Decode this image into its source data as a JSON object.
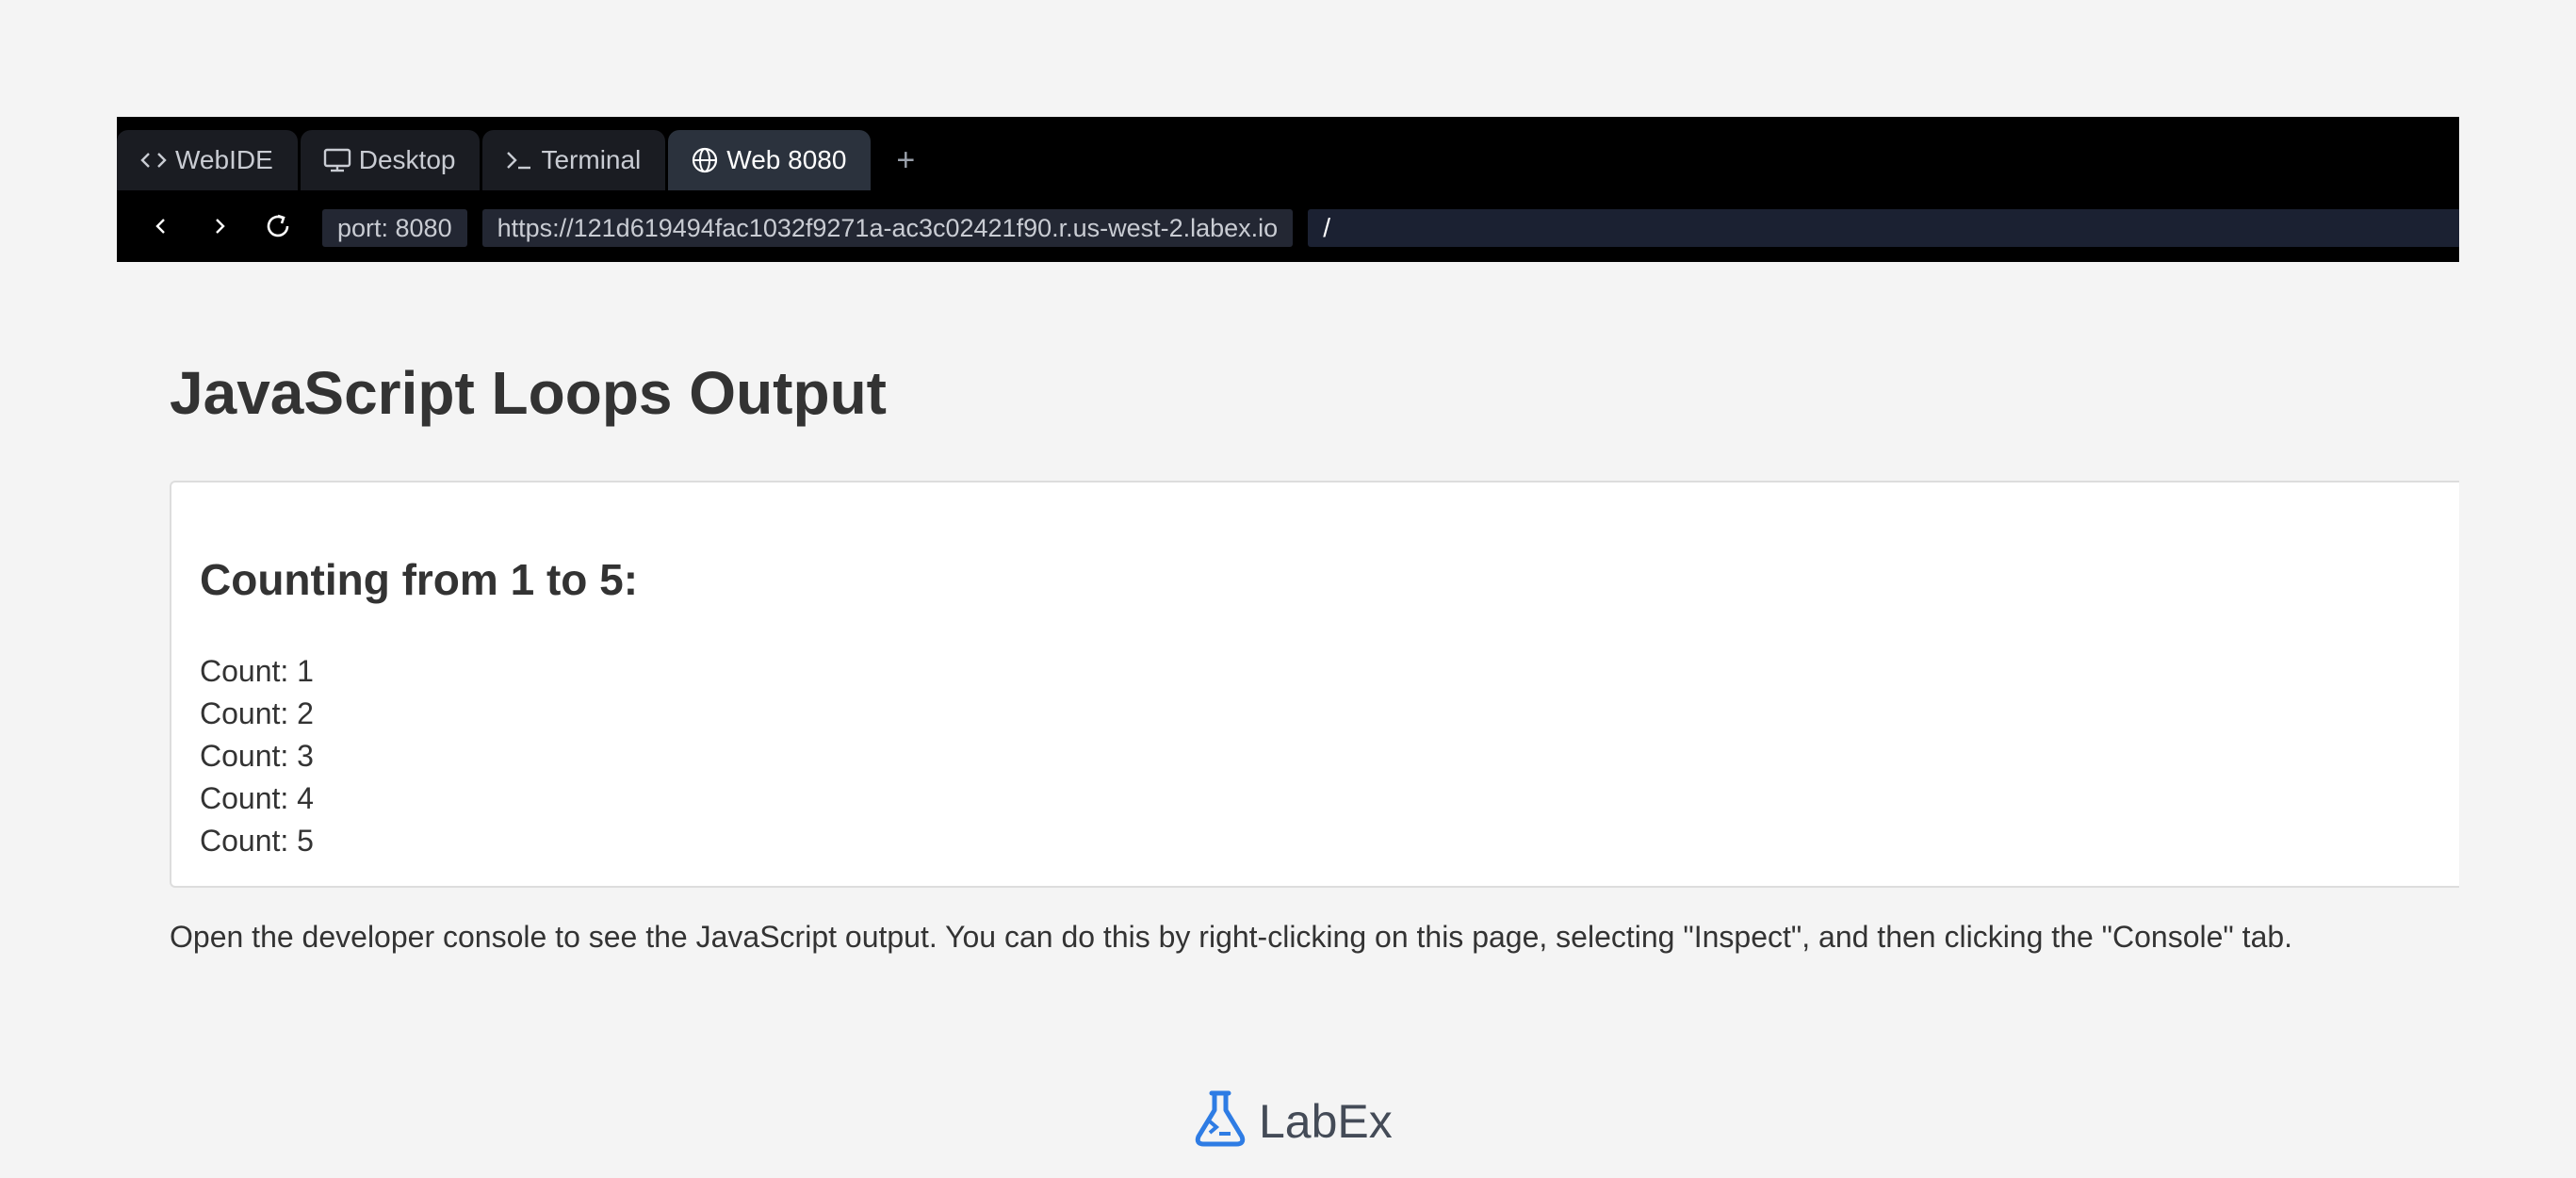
{
  "tabs": [
    {
      "label": "WebIDE",
      "icon": "code-icon"
    },
    {
      "label": "Desktop",
      "icon": "monitor-icon"
    },
    {
      "label": "Terminal",
      "icon": "terminal-icon"
    },
    {
      "label": "Web 8080",
      "icon": "globe-icon",
      "active": true
    }
  ],
  "tab_add_label": "+",
  "navbar": {
    "port": "port: 8080",
    "url": "https://121d619494fac1032f9271a-ac3c02421f90.r.us-west-2.labex.io",
    "path_value": "/"
  },
  "page": {
    "title": "JavaScript Loops Output",
    "heading": "Counting from 1 to 5:",
    "counts": [
      "Count: 1",
      "Count: 2",
      "Count: 3",
      "Count: 4",
      "Count: 5"
    ],
    "instructions": "Open the developer console to see the JavaScript output. You can do this by right-clicking on this page, selecting \"Inspect\", and then clicking the \"Console\" tab."
  },
  "brand": {
    "name": "LabEx",
    "color": "#2e7ce4"
  },
  "colors": {
    "page_bg": "#f4f4f4",
    "bar_bg": "#000000",
    "active_tab_bg": "#2b323d",
    "text": "#333333"
  }
}
